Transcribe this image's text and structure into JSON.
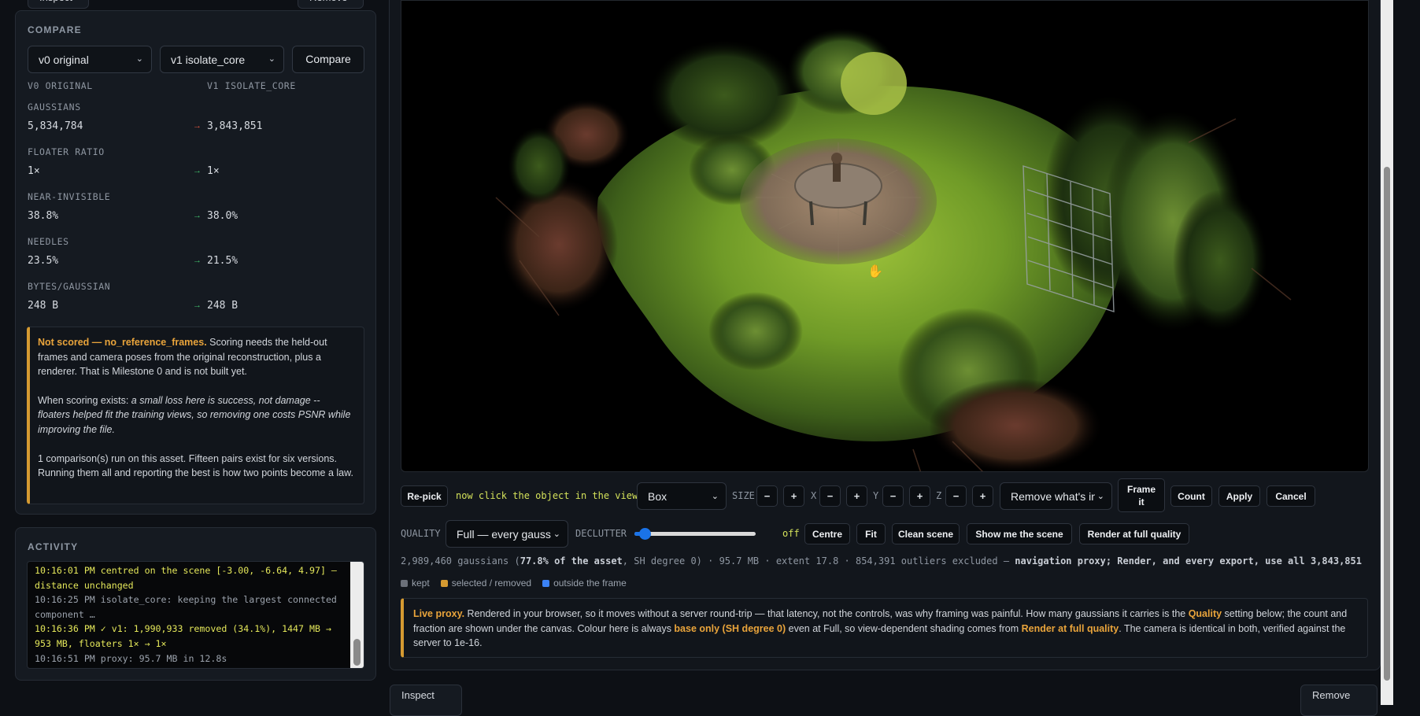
{
  "top_buttons": {
    "left": "Inspect",
    "right": "Remove"
  },
  "compare": {
    "title": "COMPARE",
    "select_a": "v0 original",
    "select_b": "v1 isolate_core",
    "button": "Compare",
    "col_a": "V0 ORIGINAL",
    "col_b": "V1 ISOLATE_CORE",
    "metrics": [
      {
        "label": "GAUSSIANS",
        "a": "5,834,784",
        "arrow": "→",
        "b": "3,843,851",
        "arrow_color": "#e0543e"
      },
      {
        "label": "FLOATER RATIO",
        "a": "1×",
        "arrow": "→",
        "b": "1×",
        "arrow_color": "#41c06c"
      },
      {
        "label": "NEAR-INVISIBLE",
        "a": "38.8%",
        "arrow": "→",
        "b": "38.0%",
        "arrow_color": "#41c06c"
      },
      {
        "label": "NEEDLES",
        "a": "23.5%",
        "arrow": "→",
        "b": "21.5%",
        "arrow_color": "#41c06c"
      },
      {
        "label": "BYTES/GAUSSIAN",
        "a": "248 B",
        "arrow": "→",
        "b": "248 B",
        "arrow_color": "#41c06c"
      }
    ],
    "note": {
      "strong": "Not scored — no_reference_frames.",
      "p1": " Scoring needs the held-out frames and camera poses from the original reconstruction, plus a renderer. That is Milestone 0 and is not built yet.",
      "p2_lead": "When scoring exists: ",
      "p2_em": "a small loss here is success, not damage -- floaters helped fit the training views, so removing one costs PSNR while improving the file.",
      "p3": "1 comparison(s) run on this asset. Fifteen pairs exist for six versions. Running them all and reporting the best is how two points become a law."
    }
  },
  "activity": {
    "title": "ACTIVITY",
    "lines": [
      {
        "text": "10:16:01 PM  centred on the scene [-3.00, -6.64, 4.97] — distance unchanged",
        "style": "hi"
      },
      {
        "text": "10:16:25 PM  isolate_core: keeping the largest connected component …",
        "style": "lo"
      },
      {
        "text": "10:16:36 PM  ✓ v1: 1,990,933 removed (34.1%), 1447 MB → 953 MB, floaters 1× → 1×",
        "style": "hi"
      },
      {
        "text": "10:16:51 PM  proxy: 95.7 MB in 12.8s",
        "style": "lo"
      }
    ]
  },
  "toolbar": {
    "repick": "Re-pick",
    "hint": "now click the object in the view",
    "shape": "Box",
    "size_label": "SIZE",
    "minus": "−",
    "plus": "+",
    "x_label": "X",
    "y_label": "Y",
    "z_label": "Z",
    "mode": "Remove what's in",
    "frame": "Frame it",
    "count": "Count",
    "apply": "Apply",
    "cancel": "Cancel"
  },
  "quality_row": {
    "quality_label": "QUALITY",
    "quality_value": "Full — every gauss",
    "declutter_label": "DECLUTTER",
    "declutter_value": 0.05,
    "declutter_state": "off",
    "centre": "Centre",
    "fit": "Fit",
    "clean": "Clean scene",
    "show": "Show me the scene",
    "render": "Render at full quality"
  },
  "status": {
    "pre": "2,989,460 gaussians (",
    "bold1": "77.8% of the asset",
    "mid": ", SH degree 0) · 95.7 MB · extent 17.8 · 854,391 outliers excluded — ",
    "bold2": "navigation proxy; Render, and every export, use all 3,843,851"
  },
  "legend": [
    {
      "label": "kept",
      "color": "#6b7079"
    },
    {
      "label": "selected / removed",
      "color": "#d59a31"
    },
    {
      "label": "outside the frame",
      "color": "#3b82f6"
    }
  ],
  "proxy_note": {
    "strong": "Live proxy.",
    "t1": " Rendered in your browser, so it moves without a server round-trip — that latency, not the controls, was why framing was painful. How many gaussians it carries is the ",
    "q": "Quality",
    "t2": " setting below; the count and fraction are shown under the canvas. Colour here is always ",
    "base": "base only (SH degree 0)",
    "t3": " even at Full, so view-dependent shading comes from ",
    "render": "Render at full quality",
    "t4": ". The camera is identical in both, verified against the server to 1e-16."
  },
  "bottom_buttons": {
    "left": "Inspect",
    "right": "Remove"
  }
}
